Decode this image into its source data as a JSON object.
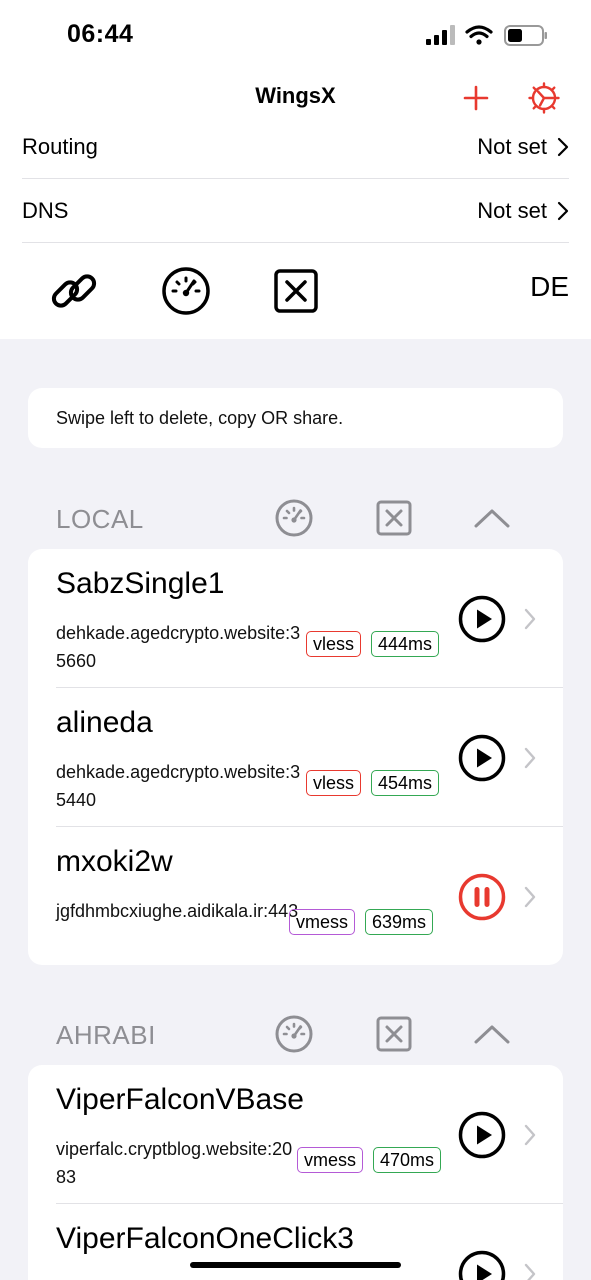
{
  "status": {
    "time": "06:44"
  },
  "nav": {
    "title": "WingsX",
    "add_icon": "plus-icon",
    "settings_icon": "gear-icon",
    "accent": "#e8392f"
  },
  "settings_rows": [
    {
      "label": "Routing",
      "value": "Not set"
    },
    {
      "label": "DNS",
      "value": "Not set"
    }
  ],
  "toolbar": {
    "icons": [
      "link-icon",
      "speedometer-icon",
      "close-box-icon"
    ],
    "country": "DE"
  },
  "hint": "Swipe left to delete, copy OR share.",
  "groups": [
    {
      "name": "LOCAL",
      "servers": [
        {
          "name": "SabzSingle1",
          "address": "dehkade.agedcrypto.website:35660",
          "protocol": "vless",
          "latency": "444ms",
          "state": "stopped"
        },
        {
          "name": "alineda",
          "address": "dehkade.agedcrypto.website:35440",
          "protocol": "vless",
          "latency": "454ms",
          "state": "stopped"
        },
        {
          "name": "mxoki2w",
          "address": "jgfdhmbcxiughe.aidikala.ir:443",
          "protocol": "vmess",
          "latency": "639ms",
          "state": "running"
        }
      ]
    },
    {
      "name": "AHRABI",
      "servers": [
        {
          "name": "ViperFalconVBase",
          "address": "viperfalc.cryptblog.website:2083",
          "protocol": "vmess",
          "latency": "470ms",
          "state": "stopped"
        },
        {
          "name": "ViperFalconOneClick3",
          "address": "",
          "protocol": "",
          "latency": "",
          "state": "stopped"
        }
      ]
    }
  ],
  "colors": {
    "vless": "#e8392f",
    "vmess": "#b45ad6",
    "latency": "#34a853",
    "running": "#e8392f",
    "muted": "#8e8e93"
  }
}
